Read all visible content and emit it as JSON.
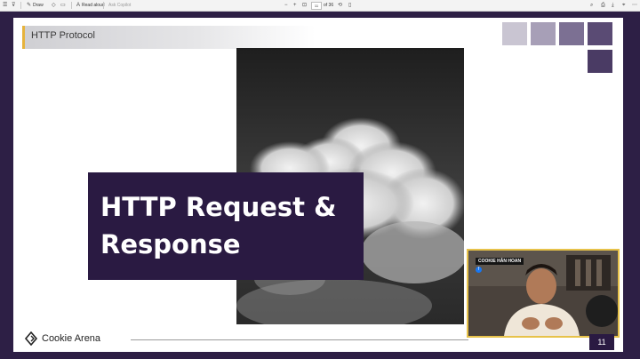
{
  "toolbar": {
    "draw_label": "Draw",
    "read_aloud_label": "Read aloud",
    "ask_label": "Ask Copilot",
    "page_current": "11",
    "page_total": "of 36"
  },
  "slide": {
    "header_title": "HTTP Protocol",
    "title_line1": "HTTP Request &",
    "title_line2": "Response",
    "brand_name": "Cookie Arena",
    "page_number": "11"
  },
  "webcam": {
    "tag": "COOKIE HÂN HOAN"
  },
  "colors": {
    "frame": "#2d1f45",
    "title_box": "#2a1a42",
    "accent": "#e6b33c",
    "square_1": "#c9c5d2",
    "square_2": "#a79fb7",
    "square_3": "#7c7093",
    "square_4": "#4a3b64"
  }
}
